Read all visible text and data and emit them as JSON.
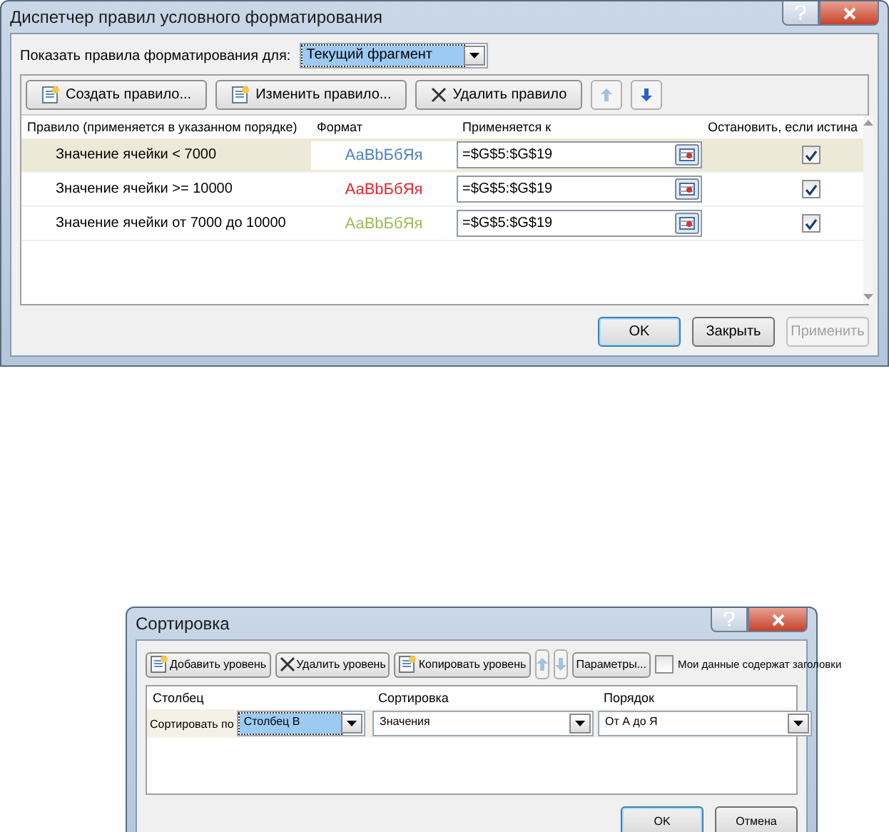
{
  "rules_dialog": {
    "title": "Диспетчер правил условного форматирования",
    "show_rules_label": "Показать правила форматирования для:",
    "show_rules_value": "Текущий фрагмент",
    "toolbar": [
      "Создать правило...",
      "Изменить правило...",
      "Удалить правило"
    ],
    "columns": [
      "Правило (применяется в указанном порядке)",
      "Формат",
      "Применяется к",
      "Остановить, если истина"
    ],
    "rules": [
      {
        "rule": "Значение ячейки < 7000",
        "sample": "АаВbБбЯя",
        "color": "#4f81bd",
        "applies_to": "=$G$5:$G$19",
        "stop": true,
        "selected": true
      },
      {
        "rule": "Значение ячейки >= 10000",
        "sample": "АаВbБбЯя",
        "color": "#e8232b",
        "applies_to": "=$G$5:$G$19",
        "stop": true,
        "selected": false
      },
      {
        "rule": "Значение ячейки от 7000 до 10000",
        "sample": "АаВbБбЯя",
        "color": "#9bbb59",
        "applies_to": "=$G$5:$G$19",
        "stop": true,
        "selected": false
      }
    ],
    "buttons": [
      {
        "label": "OK",
        "disabled": false,
        "default": true
      },
      {
        "label": "Закрыть",
        "disabled": false,
        "default": false
      },
      {
        "label": "Применить",
        "disabled": true,
        "default": false
      }
    ]
  },
  "sort_dialog": {
    "title": "Сортировка",
    "toolbar": [
      "Добавить уровень",
      "Удалить уровень",
      "Копировать уровень",
      "Параметры..."
    ],
    "headers_checkbox": {
      "label": "Мои данные содержат заголовки",
      "checked": false
    },
    "columns": [
      "Столбец",
      "Сортировка",
      "Порядок"
    ],
    "row": {
      "label": "Сортировать по",
      "column": "Столбец B",
      "sort_on": "Значения",
      "order": "От А до Я"
    },
    "buttons": [
      {
        "label": "OK",
        "disabled": false,
        "default": true
      },
      {
        "label": "Отмена",
        "disabled": false,
        "default": false
      }
    ]
  }
}
